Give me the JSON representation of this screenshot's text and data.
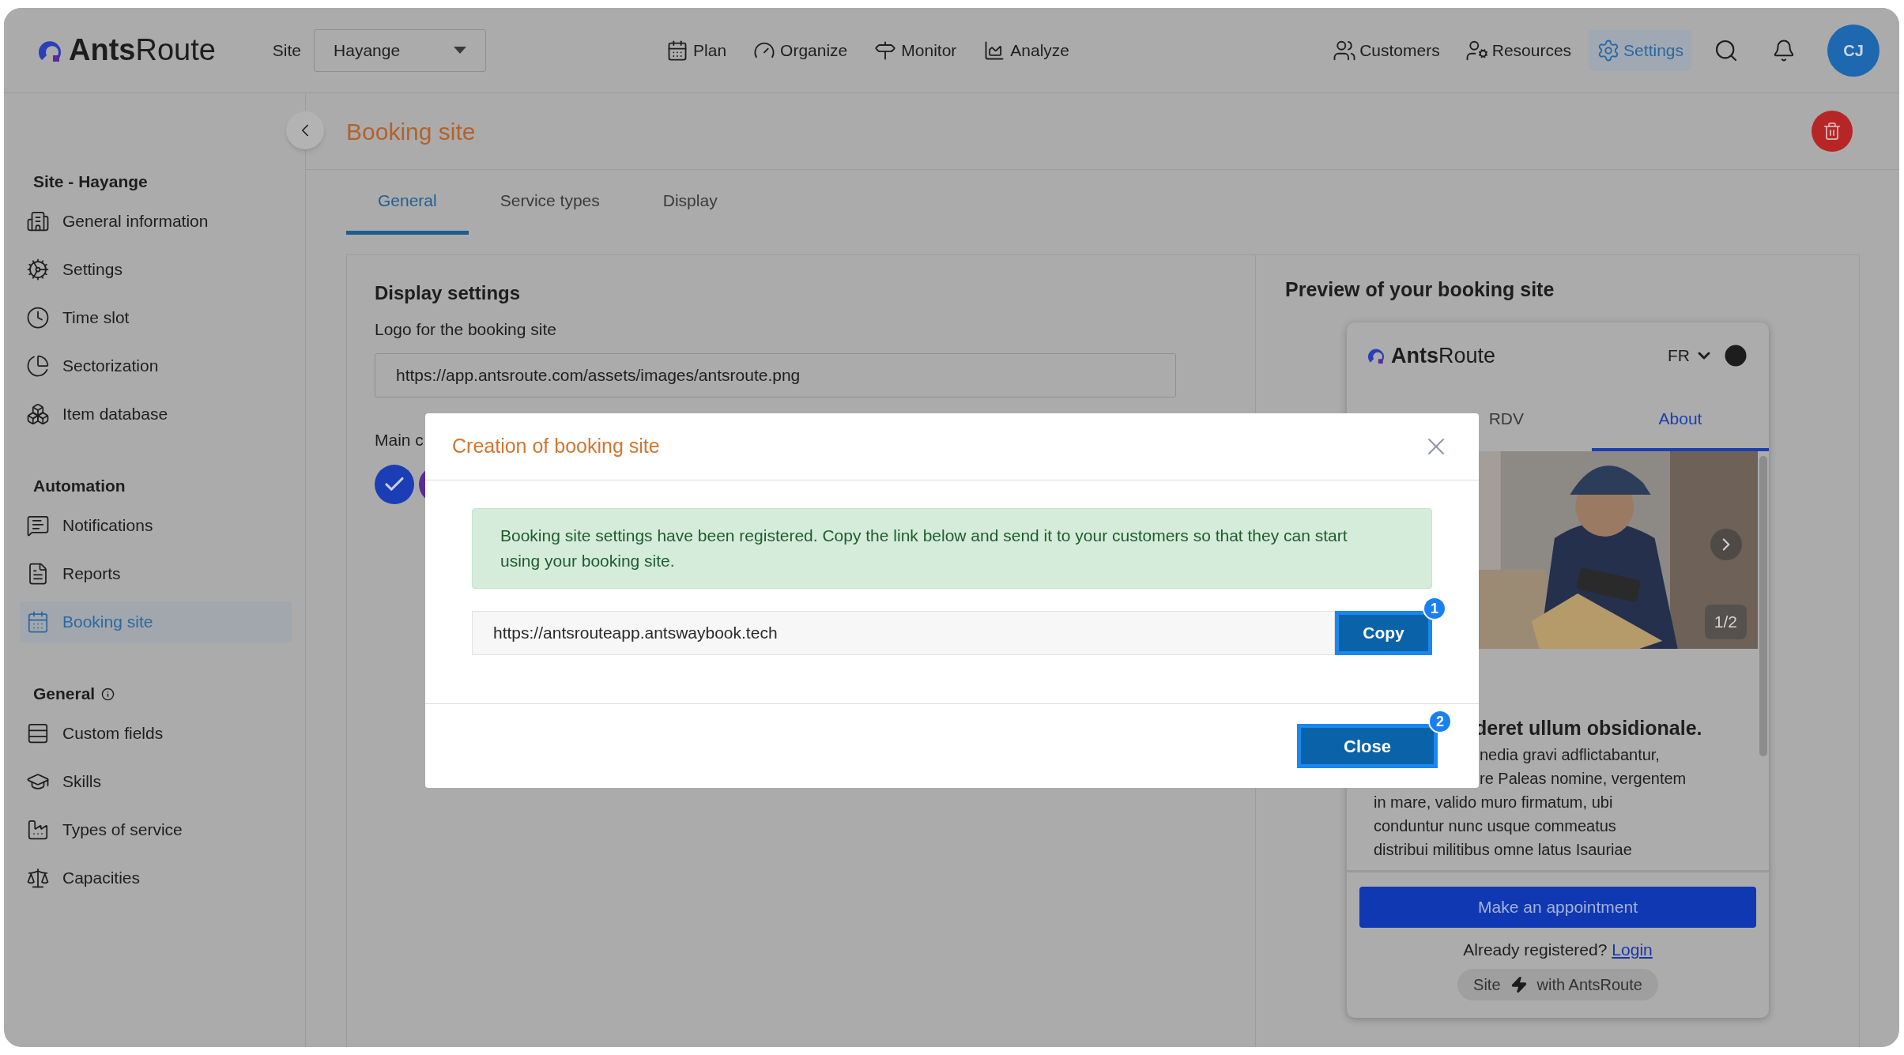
{
  "header": {
    "logo": {
      "strong": "Ants",
      "light": "Route"
    },
    "site_label": "Site",
    "site_select": {
      "value": "Hayange"
    },
    "nav": [
      {
        "label": "Plan"
      },
      {
        "label": "Organize"
      },
      {
        "label": "Monitor"
      },
      {
        "label": "Analyze"
      }
    ],
    "right_nav": [
      {
        "label": "Customers",
        "selected": false
      },
      {
        "label": "Resources",
        "selected": false
      },
      {
        "label": "Settings",
        "selected": true
      }
    ],
    "avatar": "CJ"
  },
  "sidebar": {
    "sections": [
      {
        "title": "Site - Hayange",
        "info": false,
        "items": [
          {
            "label": "General information",
            "selected": false
          },
          {
            "label": "Settings",
            "selected": false
          },
          {
            "label": "Time slot",
            "selected": false
          },
          {
            "label": "Sectorization",
            "selected": false
          },
          {
            "label": "Item database",
            "selected": false
          }
        ]
      },
      {
        "title": "Automation",
        "info": false,
        "items": [
          {
            "label": "Notifications",
            "selected": false
          },
          {
            "label": "Reports",
            "selected": false
          },
          {
            "label": "Booking site",
            "selected": true
          }
        ]
      },
      {
        "title": "General",
        "info": true,
        "items": [
          {
            "label": "Custom fields",
            "selected": false
          },
          {
            "label": "Skills",
            "selected": false
          },
          {
            "label": "Types of service",
            "selected": false
          },
          {
            "label": "Capacities",
            "selected": false
          }
        ]
      }
    ]
  },
  "page": {
    "title": "Booking site",
    "tabs": [
      {
        "label": "General",
        "selected": true
      },
      {
        "label": "Service types",
        "selected": false
      },
      {
        "label": "Display",
        "selected": false
      }
    ],
    "display_settings": {
      "title": "Display settings",
      "logo_label": "Logo for the booking site",
      "logo_url": "https://app.antsroute.com/assets/images/antsroute.png",
      "main_color_label": "Main c",
      "colors": [
        {
          "color": "#1b3db5",
          "selected": true
        },
        {
          "color": "#5a2d96",
          "selected": false
        }
      ]
    }
  },
  "preview": {
    "title": "Preview of your booking site",
    "brand": {
      "strong": "Ants",
      "light": "Route"
    },
    "language": "FR",
    "tabs": [
      {
        "label": "RDV",
        "selected": false
      },
      {
        "label": "About",
        "selected": true
      }
    ],
    "slide_counter": "1/2",
    "heading": "deret ullum obsidionale.",
    "partial_lines": [
      "nedia gravi adflictabantur,",
      "re Paleas nomine, vergentem"
    ],
    "lines": [
      "in mare, valido muro firmatum, ubi",
      "conduntur nunc usque commeatus",
      "distribui militibus omne latus Isauriae"
    ],
    "button": "Make an appointment",
    "login_prompt": "Already registered?",
    "login_link": "Login",
    "footer": {
      "left": "Site",
      "right": "with AntsRoute"
    }
  },
  "modal": {
    "title": "Creation of booking site",
    "message": "Booking site settings have been registered. Copy the link below and send it to your customers so that they can start using your booking site.",
    "link": "https://antsrouteapp.antswaybook.tech",
    "copy_button": {
      "label": "Copy",
      "badge": "1"
    },
    "close_button": {
      "label": "Close",
      "badge": "2"
    }
  }
}
